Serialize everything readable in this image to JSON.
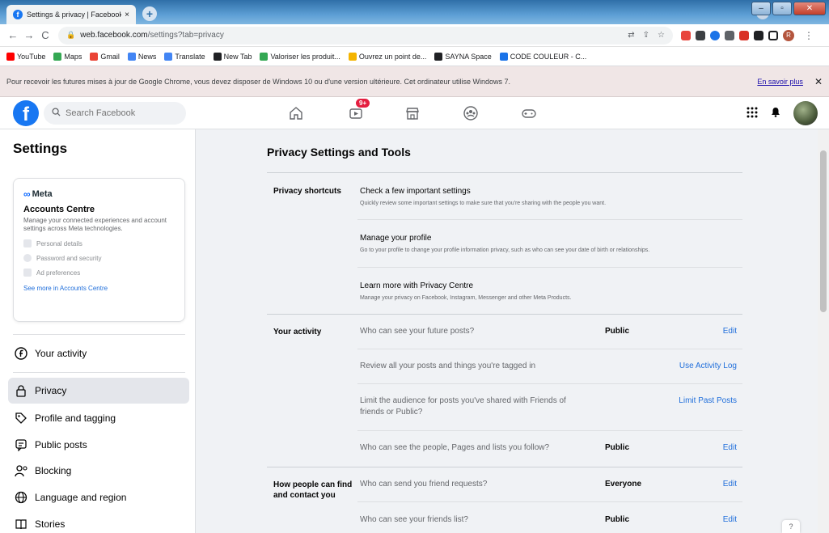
{
  "browser": {
    "tab_title": "Settings & privacy | Facebook",
    "tab_close": "×",
    "new_tab": "+",
    "url_host": "web.facebook.com",
    "url_path": "/settings?tab=privacy",
    "bookmarks": [
      {
        "label": "YouTube",
        "color": "#ff0000"
      },
      {
        "label": "Maps",
        "color": "#34a853"
      },
      {
        "label": "Gmail",
        "color": "#ea4335"
      },
      {
        "label": "News",
        "color": "#4285f4"
      },
      {
        "label": "Translate",
        "color": "#4285f4"
      },
      {
        "label": "New Tab",
        "color": "#202124"
      },
      {
        "label": "Valoriser les produit...",
        "color": "#34a853"
      },
      {
        "label": "Ouvrez un point de...",
        "color": "#f4b400"
      },
      {
        "label": "SAYNA Space",
        "color": "#202124"
      },
      {
        "label": "CODE COULEUR - C...",
        "color": "#1a73e8"
      }
    ],
    "infobar_text": "Pour recevoir les futures mises à jour de Google Chrome, vous devez disposer de Windows 10 ou d'une version ultérieure. Cet ordinateur utilise Windows 7.",
    "infobar_link": "En savoir plus",
    "infobar_close": "✕",
    "profile_initial": "R"
  },
  "fbnav": {
    "logo": "f",
    "search_placeholder": "Search Facebook",
    "watch_badge": "9+"
  },
  "sidebar": {
    "title": "Settings",
    "meta": {
      "brand": "Meta",
      "title": "Accounts Centre",
      "description": "Manage your connected experiences and account settings across Meta technologies.",
      "items": [
        "Personal details",
        "Password and security",
        "Ad preferences"
      ],
      "link": "See more in Accounts Centre"
    },
    "nav": [
      {
        "label": "Your activity",
        "icon": "facebook-circle-icon"
      },
      {
        "label": "Privacy",
        "icon": "lock-icon"
      },
      {
        "label": "Profile and tagging",
        "icon": "tag-icon"
      },
      {
        "label": "Public posts",
        "icon": "public-posts-icon"
      },
      {
        "label": "Blocking",
        "icon": "blocking-icon"
      },
      {
        "label": "Language and region",
        "icon": "globe-icon"
      },
      {
        "label": "Stories",
        "icon": "book-icon"
      }
    ]
  },
  "main": {
    "title": "Privacy Settings and Tools",
    "shortcuts": {
      "label": "Privacy shortcuts",
      "items": [
        {
          "title": "Check a few important settings",
          "subtitle": "Quickly review some important settings to make sure that you're sharing with the people you want."
        },
        {
          "title": "Manage your profile",
          "subtitle": "Go to your profile to change your profile information privacy, such as who can see your date of birth or relationships."
        },
        {
          "title": "Learn more with Privacy Centre",
          "subtitle": "Manage your privacy on Facebook, Instagram, Messenger and other Meta Products."
        }
      ]
    },
    "activity": {
      "label": "Your activity",
      "rows": [
        {
          "question": "Who can see your future posts?",
          "value": "Public",
          "action": "Edit"
        },
        {
          "question": "Review all your posts and things you're tagged in",
          "value": "",
          "action": "Use Activity Log"
        },
        {
          "question": "Limit the audience for posts you've shared with Friends of friends or Public?",
          "value": "",
          "action": "Limit Past Posts"
        },
        {
          "question": "Who can see the people, Pages and lists you follow?",
          "value": "Public",
          "action": "Edit"
        }
      ]
    },
    "find_contact": {
      "label": "How people can find and contact you",
      "rows": [
        {
          "question": "Who can send you friend requests?",
          "value": "Everyone",
          "action": "Edit"
        },
        {
          "question": "Who can see your friends list?",
          "value": "Public",
          "action": "Edit"
        }
      ]
    }
  }
}
